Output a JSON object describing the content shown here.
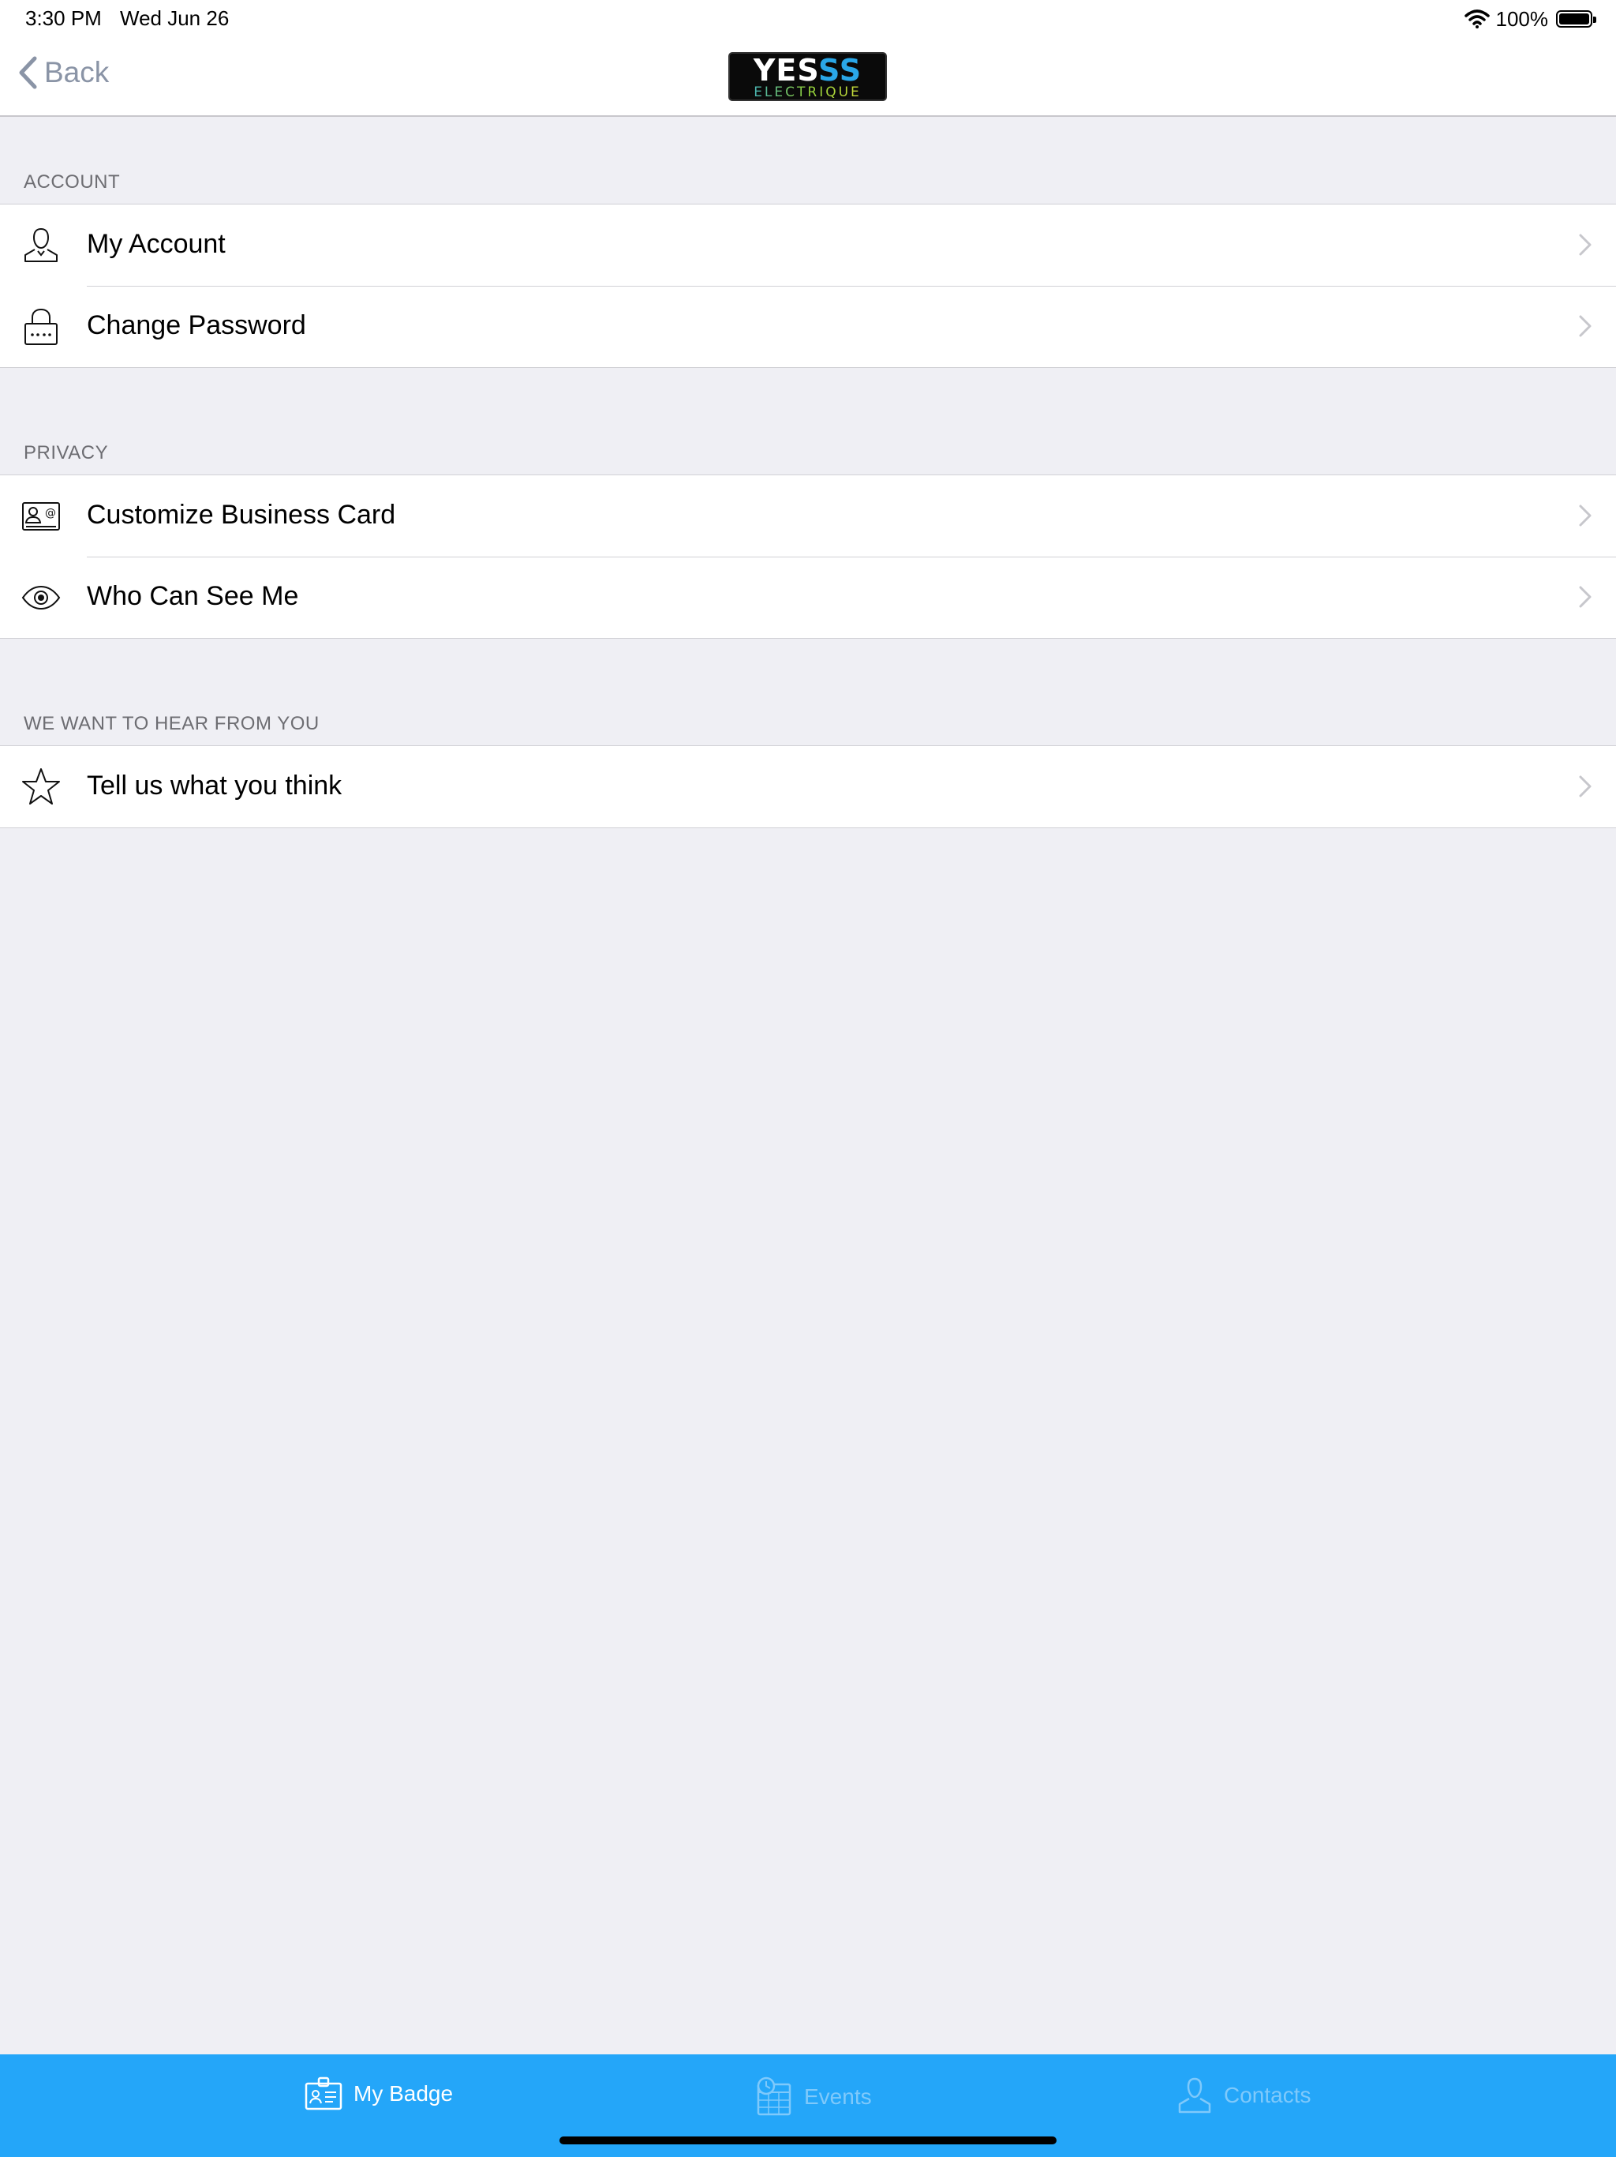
{
  "status_bar": {
    "time": "3:30 PM",
    "date": "Wed Jun 26",
    "battery_level": "100%"
  },
  "nav": {
    "back_label": "Back",
    "logo_text_top_a": "YES",
    "logo_text_top_b": "SS",
    "logo_text_bottom": "ELECTRIQUE"
  },
  "sections": [
    {
      "header": "ACCOUNT",
      "items": [
        {
          "label": "My Account",
          "icon": "person-icon"
        },
        {
          "label": "Change Password",
          "icon": "lock-icon"
        }
      ]
    },
    {
      "header": "PRIVACY",
      "items": [
        {
          "label": "Customize Business Card",
          "icon": "business-card-icon"
        },
        {
          "label": "Who Can See Me",
          "icon": "eye-icon"
        }
      ]
    },
    {
      "header": "WE WANT TO HEAR FROM YOU",
      "items": [
        {
          "label": "Tell us what you think",
          "icon": "star-icon"
        }
      ]
    }
  ],
  "tab_bar": {
    "tabs": [
      {
        "label": "My Badge",
        "active": true
      },
      {
        "label": "Events",
        "active": false
      },
      {
        "label": "Contacts",
        "active": false
      }
    ]
  },
  "colors": {
    "accent": "#24a6f9",
    "background": "#efeff4",
    "back_text": "#8a94a6"
  }
}
